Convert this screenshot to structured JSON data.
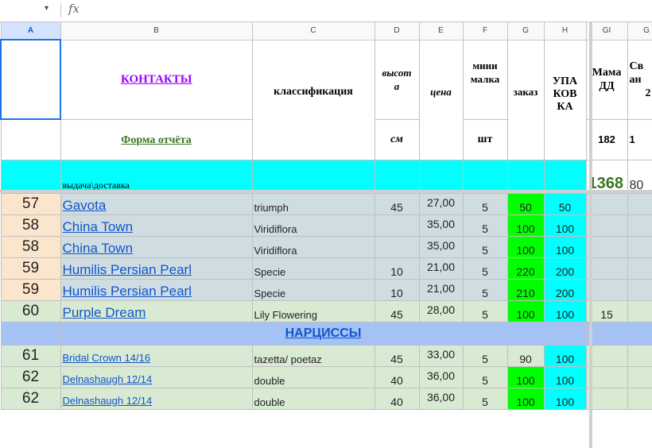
{
  "formula_bar": {
    "name_box_arrow": "▾",
    "fx_label": "fx"
  },
  "columns": [
    "A",
    "B",
    "C",
    "D",
    "E",
    "F",
    "G",
    "H",
    "GI",
    "G"
  ],
  "header": {
    "contacts": "КОНТАКТЫ",
    "classification": "классификация",
    "height_line1": "высот",
    "height_line2": "а",
    "price": "цена",
    "minimum_line1": "мини",
    "minimum_line2": "малка",
    "order": "заказ",
    "packaging_line1": "УПА",
    "packaging_line2": "КОВ",
    "packaging_line3": "КА",
    "mama_line1": "Мама",
    "mama_line2": "ДД",
    "sv_line1": "Св",
    "sv_line2": "ан",
    "sv_line3": "2",
    "report_form": "Форма отчёта",
    "height_unit": "см",
    "qty_unit": "шт",
    "mama_value": "182",
    "sv_value": "1",
    "delivery": "выдача\\доставка",
    "total_gi": "1368",
    "total_next": "80"
  },
  "rows": [
    {
      "a": "57",
      "name": "Gavota",
      "cls": "triumph",
      "h": "45",
      "price": "27,00",
      "min": "5",
      "order": "50",
      "pack": "50",
      "gi": "",
      "bg": "#cfdde2",
      "abg": "#fce5cd",
      "obg": "#00ff00",
      "pbg": "#00ffff",
      "nsize": 17
    },
    {
      "a": "58",
      "name": "China Town",
      "cls": "Viridiflora",
      "h": "",
      "price": "35,00",
      "min": "5",
      "order": "100",
      "pack": "100",
      "gi": "",
      "bg": "#cfdde2",
      "abg": "#fce5cd",
      "obg": "#00ff00",
      "pbg": "#00ffff",
      "nsize": 17
    },
    {
      "a": "58",
      "name": "China Town",
      "cls": "Viridiflora",
      "h": "",
      "price": "35,00",
      "min": "5",
      "order": "100",
      "pack": "100",
      "gi": "",
      "bg": "#cfdde2",
      "abg": "#fce5cd",
      "obg": "#00ff00",
      "pbg": "#00ffff",
      "nsize": 17
    },
    {
      "a": "59",
      "name": "Humilis Persian Pearl",
      "cls": " Specie",
      "h": "10",
      "price": "21,00",
      "min": "5",
      "order": "220",
      "pack": "200",
      "gi": "",
      "bg": "#cfdde2",
      "abg": "#fce5cd",
      "obg": "#00ff00",
      "pbg": "#00ffff",
      "nsize": 17
    },
    {
      "a": "59",
      "name": "Humilis Persian Pearl",
      "cls": " Specie",
      "h": "10",
      "price": "21,00",
      "min": "5",
      "order": "210",
      "pack": "200",
      "gi": "",
      "bg": "#cfdde2",
      "abg": "#fce5cd",
      "obg": "#00ff00",
      "pbg": "#00ffff",
      "nsize": 17
    },
    {
      "a": "60",
      "name": "Purple Dream",
      "cls": "Lily Flowering",
      "h": "45",
      "price": "28,00",
      "min": "5",
      "order": "100",
      "pack": "100",
      "gi": "15",
      "bg": "#d9ead3",
      "abg": "#d9ead3",
      "obg": "#00ff00",
      "pbg": "#00ffff",
      "nsize": 17
    }
  ],
  "section": {
    "title": "НАРЦИССЫ"
  },
  "rows2": [
    {
      "a": "61",
      "name": "Bridal Crown 14/16",
      "cls": "tazetta/ poetaz",
      "h": "45",
      "price": "33,00",
      "min": "5",
      "order": "90",
      "pack": "100",
      "gi": "",
      "bg": "#d9ead3",
      "abg": "#d9ead3",
      "obg": "#d9ead3",
      "pbg": "#00ffff",
      "nsize": 13
    },
    {
      "a": "62",
      "name": "Delnashaugh 12/14",
      "cls": "double",
      "h": "40",
      "price": "36,00",
      "min": "5",
      "order": "100",
      "pack": "100",
      "gi": "",
      "bg": "#d9ead3",
      "abg": "#d9ead3",
      "obg": "#00ff00",
      "pbg": "#00ffff",
      "nsize": 13
    },
    {
      "a": "62",
      "name": "Delnashaugh 12/14",
      "cls": "double",
      "h": "40",
      "price": "36,00",
      "min": "5",
      "order": "100",
      "pack": "100",
      "gi": "",
      "bg": "#d9ead3",
      "abg": "#d9ead3",
      "obg": "#00ff00",
      "pbg": "#00ffff",
      "nsize": 13
    }
  ]
}
